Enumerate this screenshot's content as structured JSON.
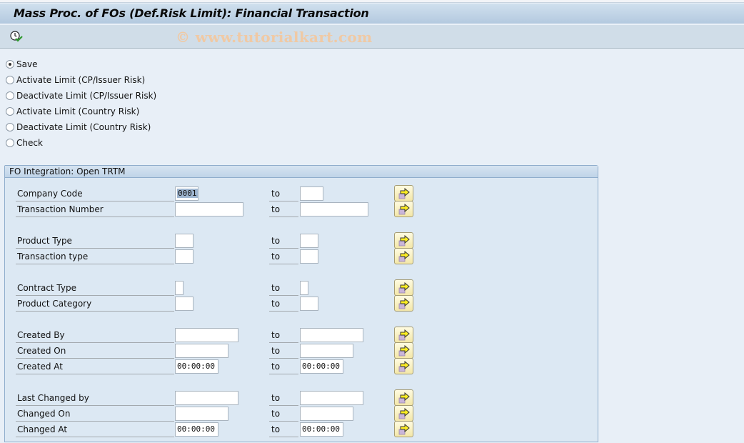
{
  "window": {
    "title": "Mass Proc. of FOs (Def.Risk Limit): Financial Transaction"
  },
  "toolbar": {
    "execute_icon": "execute-clock-check-icon",
    "watermark": "© www.tutorialkart.com"
  },
  "radios": [
    {
      "label": "Save",
      "checked": true
    },
    {
      "label": "Activate Limit (CP/Issuer Risk)",
      "checked": false
    },
    {
      "label": "Deactivate Limit (CP/Issuer Risk)",
      "checked": false
    },
    {
      "label": "Activate Limit (Country Risk)",
      "checked": false
    },
    {
      "label": "Deactivate Limit (Country Risk)",
      "checked": false
    },
    {
      "label": "Check",
      "checked": false
    }
  ],
  "group": {
    "title": "FO Integration: Open TRTM",
    "to_label": "to",
    "multi_select_icon": "multiple-selection-arrow-icon",
    "fields": [
      {
        "label": "Company Code",
        "from": "0001",
        "to": ""
      },
      {
        "label": "Transaction Number",
        "from": "",
        "to": ""
      },
      {
        "label": "Product Type",
        "from": "",
        "to": ""
      },
      {
        "label": "Transaction type",
        "from": "",
        "to": ""
      },
      {
        "label": "Contract Type",
        "from": "",
        "to": ""
      },
      {
        "label": "Product Category",
        "from": "",
        "to": ""
      },
      {
        "label": "Created By",
        "from": "",
        "to": ""
      },
      {
        "label": "Created On",
        "from": "",
        "to": ""
      },
      {
        "label": "Created At",
        "from": "00:00:00",
        "to": "00:00:00"
      },
      {
        "label": "Last Changed by",
        "from": "",
        "to": ""
      },
      {
        "label": "Changed On",
        "from": "",
        "to": ""
      },
      {
        "label": "Changed At",
        "from": "00:00:00",
        "to": "00:00:00"
      }
    ]
  }
}
